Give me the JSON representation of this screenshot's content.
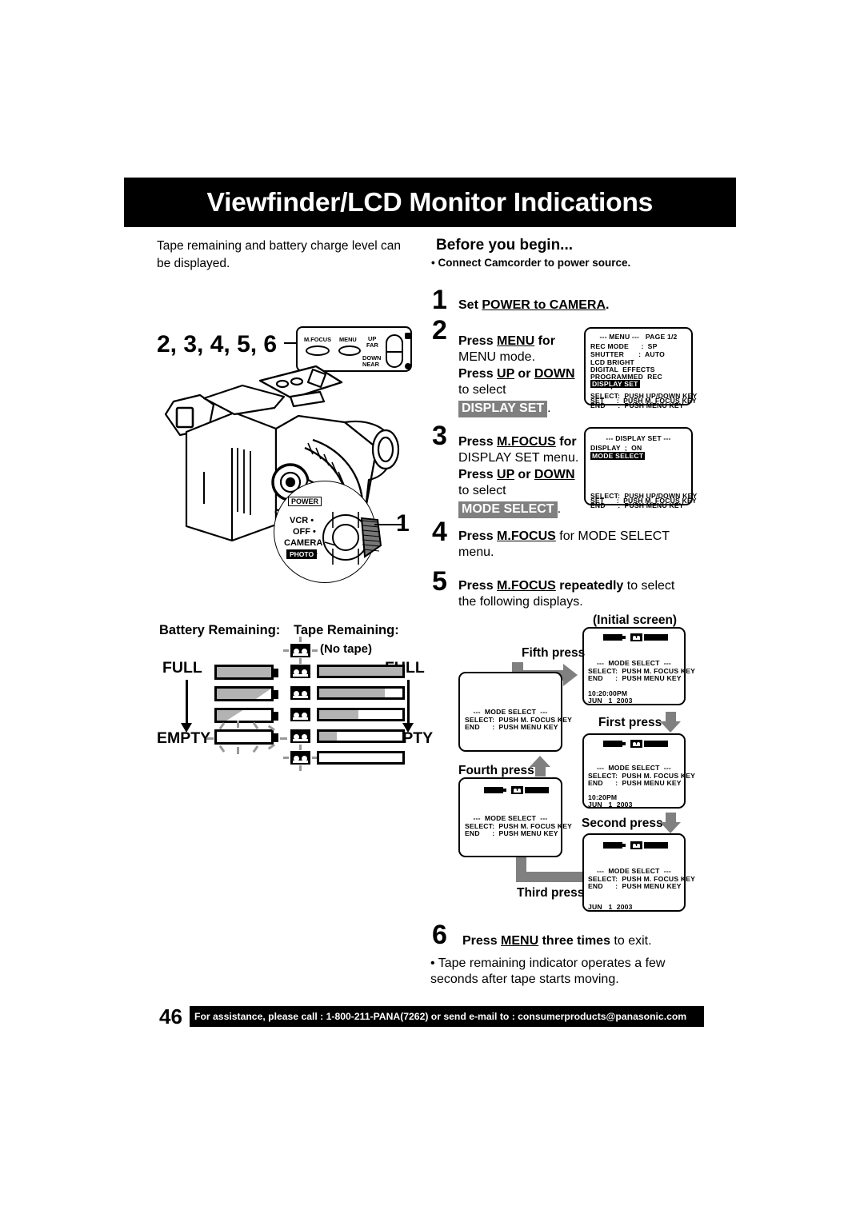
{
  "header": {
    "title": "Viewfinder/LCD Monitor Indications"
  },
  "intro": {
    "text": "Tape remaining and battery charge level can be displayed."
  },
  "before_you_begin": {
    "heading": "Before you begin...",
    "bullet": "• Connect Camcorder to power source."
  },
  "steps": [
    {
      "num": "1",
      "line1_pre": "Set ",
      "line1_u": "POWER to CAMERA",
      "line1_post": "."
    },
    {
      "num": "2",
      "l1a": "Press ",
      "l1u": "MENU",
      "l1b": " for",
      "l2": "MENU mode.",
      "l3a": "Press ",
      "l3u1": "UP",
      "l3b": " or ",
      "l3u2": "DOWN",
      "l4": "to select",
      "l5_chip": "DISPLAY SET",
      "l5_post": "."
    },
    {
      "num": "3",
      "l1a": "Press ",
      "l1u": "M.FOCUS",
      "l1b": " for",
      "l2": "DISPLAY SET menu.",
      "l3a": "Press ",
      "l3u1": "UP",
      "l3b": " or ",
      "l3u2": "DOWN",
      "l4": "to select",
      "l5_chip": "MODE SELECT",
      "l5_post": "."
    },
    {
      "num": "4",
      "l1a": "Press ",
      "l1u": "M.FOCUS",
      "l1b": " for MODE SELECT",
      "l2": "menu."
    },
    {
      "num": "5",
      "l1a": "Press ",
      "l1u": "M.FOCUS",
      "l1b": " repeatedly",
      "l1c": " to select",
      "l2": "the following displays."
    },
    {
      "num": "6",
      "l1a": "Press ",
      "l1u": "MENU",
      "l1b": " three times",
      "l1c": " to exit."
    }
  ],
  "note_bullet": "• Tape remaining indicator operates a few seconds after tape starts moving.",
  "menu_screen_1": {
    "title": "--- MENU ---   PAGE 1/2",
    "rows": [
      "REC MODE      :  SP",
      "SHUTTER       :  AUTO",
      "LCD BRIGHT",
      "DIGITAL  EFFECTS",
      "PROGRAMMED  REC"
    ],
    "highlighted": "DISPLAY SET",
    "marker": "▼",
    "footer": [
      "SELECT:  PUSH UP/DOWN KEY",
      "SET      :  PUSH M. FOCUS KEY",
      "END      :  PUSH MENU KEY"
    ]
  },
  "menu_screen_2": {
    "title": "--- DISPLAY SET ---",
    "rows": [
      "DISPLAY  ;  ON"
    ],
    "highlighted": "MODE SELECT",
    "footer": [
      "SELECT:  PUSH UP/DOWN KEY",
      "SET      :  PUSH M. FOCUS KEY",
      "END      :  PUSH MENU KEY"
    ]
  },
  "mode_select_common": {
    "title": "---  MODE SELECT  ---",
    "line_select": "SELECT:  PUSH M. FOCUS KEY",
    "line_end": "END      :  PUSH MENU KEY"
  },
  "flow": {
    "initial_label": "(Initial screen)",
    "press_labels": {
      "first": "First press",
      "second": "Second press",
      "third": "Third press",
      "fourth": "Fourth press",
      "fifth": "Fifth press"
    },
    "screens": {
      "initial": {
        "icons": true,
        "time": "10:20:00PM",
        "date": "JUN   1  2003"
      },
      "first": {
        "icons": true,
        "time": "10:20PM",
        "date": "JUN   1  2003"
      },
      "second": {
        "icons": true,
        "time": "",
        "date": "JUN   1  2003"
      },
      "third": {
        "icons": true,
        "time": "",
        "date": ""
      },
      "fourth": {
        "icons": false,
        "time": "",
        "date": ""
      }
    }
  },
  "indicators": {
    "battery_heading": "Battery Remaining:",
    "tape_heading": "Tape Remaining:",
    "full_left": "FULL",
    "empty_left": "EMPTY",
    "full_right": "FULL",
    "empty_right": "EMPTY",
    "no_tape": "(No tape)"
  },
  "camcorder": {
    "step_numbers": "2, 3, 4, 5, 6",
    "callout_power": "1",
    "buttons": {
      "mfocus": "M.FOCUS",
      "menu": "MENU",
      "up": "UP",
      "far": "FAR",
      "down": "DOWN",
      "near": "NEAR",
      "minus": "–",
      "plus": "+"
    },
    "power_label": "POWER",
    "dial": [
      "VCR •",
      "OFF •",
      "CAMERA •"
    ],
    "dial_photo": "PHOTO",
    "dial_photo_dot": "•"
  },
  "footer": {
    "page_number": "46",
    "text": "For assistance, please call : 1-800-211-PANA(7262) or send e-mail to : consumerproducts@panasonic.com"
  }
}
